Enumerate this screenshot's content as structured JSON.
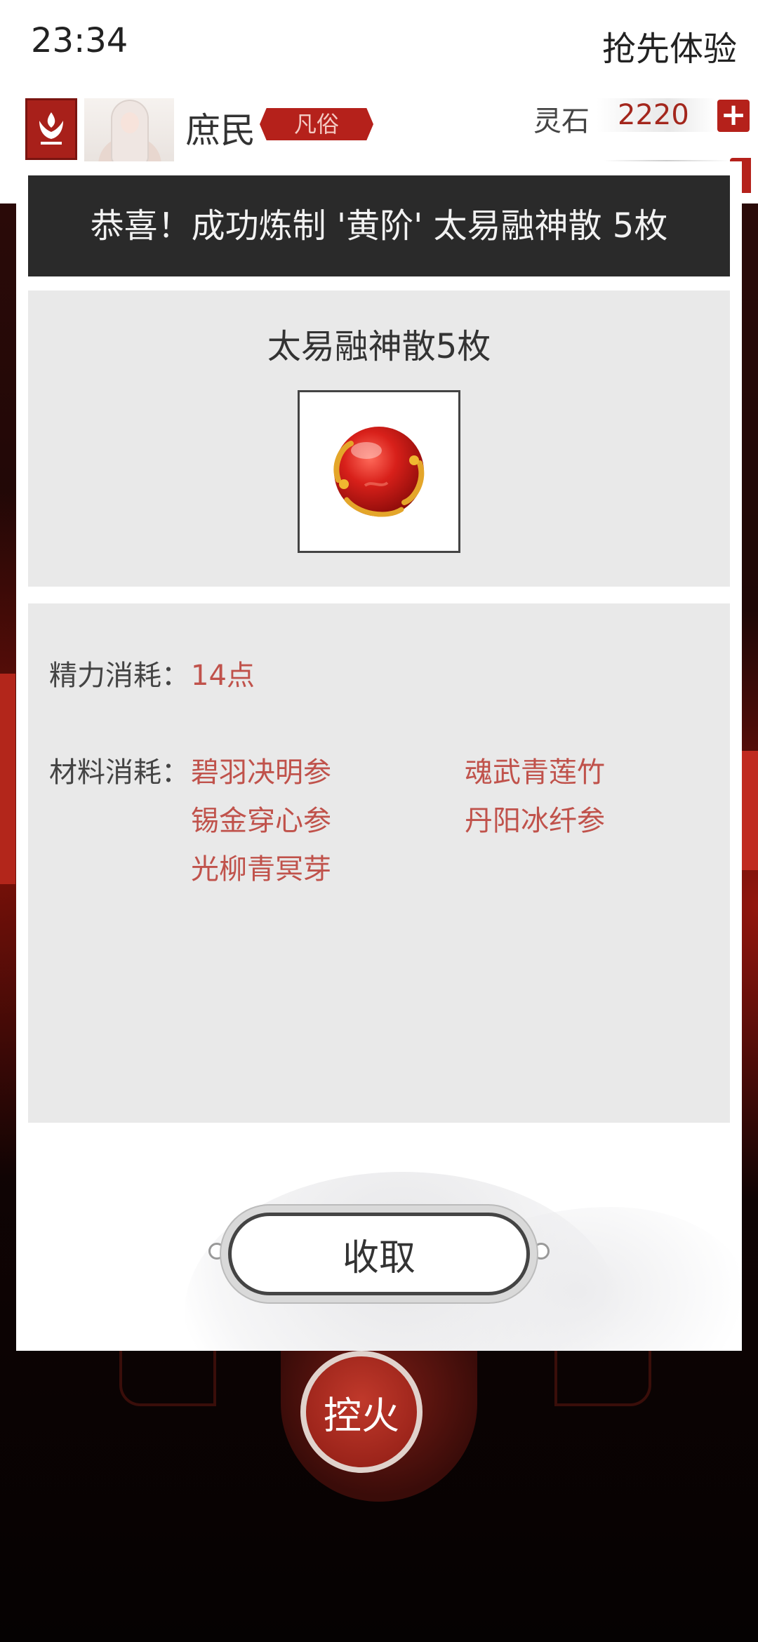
{
  "status_bar": {
    "time": "23:34",
    "right_text": "抢先体验"
  },
  "header": {
    "rank_name": "庶民",
    "rank_badge": "凡俗",
    "currency": {
      "label": "灵石",
      "value": "2220",
      "plus": "+"
    }
  },
  "modal": {
    "title": "恭喜！成功炼制 '黄阶' 太易融神散 5枚",
    "result": {
      "name": "太易融神散5枚",
      "item_icon": "red-pill-orb"
    },
    "energy": {
      "label": "精力消耗：",
      "value": "14点"
    },
    "materials": {
      "label": "材料消耗：",
      "items": [
        "碧羽决明参",
        "魂武青莲竹",
        "锡金穿心参",
        "丹阳冰纤参",
        "光柳青冥芽"
      ]
    },
    "collect_button": "收取"
  },
  "fire_button": "控火",
  "colors": {
    "accent": "#b5211b",
    "material_text": "#c0524b",
    "title_bar": "#2a2a2a"
  }
}
